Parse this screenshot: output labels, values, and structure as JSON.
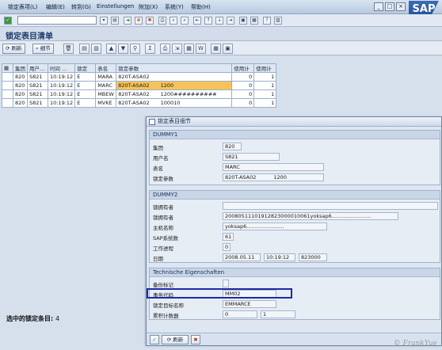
{
  "menu": {
    "items": [
      "锁定表项(L)",
      "编辑(E)",
      "转到(G)",
      "Einstellungen",
      "附加(X)",
      "系统(Y)",
      "帮助(H)"
    ],
    "logo": "SAP"
  },
  "toolbar": {
    "command_value": "",
    "icons": [
      "check-icon",
      "save-icon",
      "back-icon",
      "exit-icon",
      "cancel-icon",
      "print-icon",
      "find-icon",
      "help-icon"
    ]
  },
  "page": {
    "title": "锁定表目清单"
  },
  "app_toolbar": {
    "refresh_label": "刷新",
    "details_label": "细节"
  },
  "grid": {
    "headers": [
      "集团",
      "用户...",
      "时间 ...",
      "锁定",
      "表名",
      "锁定参数",
      "使用计",
      "使用计"
    ],
    "rows": [
      {
        "client": "820",
        "user": "S821",
        "time": "10:19:12",
        "lock": "E",
        "table": "MARA",
        "arg_prefix": "820T-ASA02",
        "arg_suffix": "",
        "cnt1": "0",
        "cnt2": "1"
      },
      {
        "client": "820",
        "user": "S821",
        "time": "10:19:12",
        "lock": "E",
        "table": "MARC",
        "arg_prefix": "820T-ASA02",
        "arg_suffix": "1200",
        "cnt1": "0",
        "cnt2": "1"
      },
      {
        "client": "820",
        "user": "S821",
        "time": "10:19:12",
        "lock": "E",
        "table": "MBEW",
        "arg_prefix": "820T-ASA02",
        "arg_suffix": "1200##########",
        "cnt1": "0",
        "cnt2": "1"
      },
      {
        "client": "820",
        "user": "S821",
        "time": "10:19:12",
        "lock": "E",
        "table": "MVKE",
        "arg_prefix": "820T-ASA02",
        "arg_suffix": "100010",
        "cnt1": "0",
        "cnt2": "1"
      }
    ]
  },
  "selected": {
    "label": "选中的锁定条目:",
    "count": "4"
  },
  "dialog": {
    "title": "锁定表目细节",
    "dummy1": {
      "header": "DUMMY1",
      "client_label": "集团",
      "client": "820",
      "user_label": "用户名",
      "user": "S821",
      "table_label": "表名",
      "table": "MARC",
      "arg_label": "锁定参数",
      "arg_prefix": "820T-ASA02",
      "arg_suffix": "1200"
    },
    "dummy2": {
      "header": "DUMMY2",
      "owner_label": "锁拥有者",
      "owner": "",
      "owner2_label": "锁拥有者",
      "owner2": "20080511101912823000010061yoksap6........................",
      "host_label": "主机名称",
      "host": "yoksap6.......................",
      "sys_label": "SAP系统数",
      "sys": "61",
      "proc_label": "工作进程",
      "proc": "0",
      "date_label": "日期",
      "date": "2008.05.11",
      "time": "10:19:12",
      "micro": "823000"
    },
    "tech": {
      "header": "Technische Eigenschaften",
      "backup_label": "备份标记",
      "backup": "",
      "tcode_label": "事务代码",
      "tcode": "MM02",
      "lockobj_label": "锁定目标名称",
      "lockobj": "EMMARCE",
      "counter_label": "累积计数器",
      "counter1": "0",
      "counter2": "1"
    },
    "footer": {
      "refresh_label": "刷新"
    }
  },
  "watermark": "© FrankYue"
}
